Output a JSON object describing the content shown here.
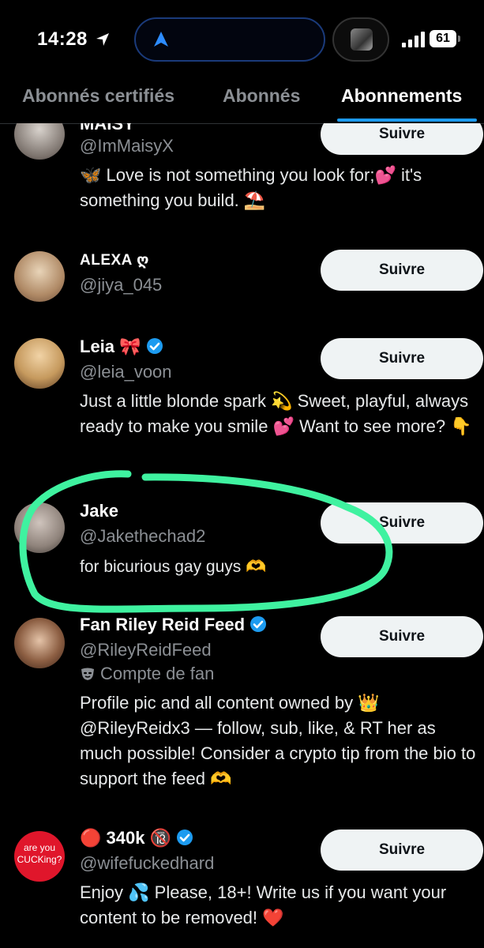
{
  "status_bar": {
    "time": "14:28",
    "battery": "61"
  },
  "tabs": [
    {
      "label": "Abonnés certifiés",
      "active": false
    },
    {
      "label": "Abonnés",
      "active": false
    },
    {
      "label": "Abonnements",
      "active": true
    }
  ],
  "accounts": [
    {
      "name_partial": "MAISY",
      "handle": "@ImMaisyX",
      "bio": "🦋 Love is not something you look for;💕 it's something you build. ⛱️",
      "follow_label": "Suivre"
    },
    {
      "name": "ALEXA ღ",
      "handle": "@jiya_045",
      "follow_label": "Suivre"
    },
    {
      "name": "Leia 🎀",
      "verified": true,
      "handle": "@leia_voon",
      "bio": "Just a little blonde spark 💫 Sweet, playful, always ready to make you smile 💕 Want to see more? 👇",
      "follow_label": "Suivre"
    },
    {
      "name": "Jake",
      "handle": "@Jakethechad2",
      "bio": "for bicurious gay guys 🫶",
      "follow_label": "Suivre"
    },
    {
      "name": "Fan Riley Reid Feed",
      "verified": true,
      "handle": "@RileyReidFeed",
      "label": "Compte de fan",
      "bio": "Profile pic and all content owned by 👑 @RileyReidx3 — follow, sub, like, & RT her as much possible! Consider a crypto tip from the bio to support the feed 🫶",
      "follow_label": "Suivre"
    },
    {
      "name": "🔴 340k 🔞",
      "verified": true,
      "avatar_text": "are you CUCKing?",
      "handle": "@wifefuckedhard",
      "bio": "Enjoy 💦 Please, 18+! Write us if you want your content to be removed! ❤️",
      "follow_label": "Suivre"
    }
  ],
  "colors": {
    "accent": "#1d9bf0",
    "highlight": "#3ff2a0",
    "muted": "#8b8f94"
  }
}
